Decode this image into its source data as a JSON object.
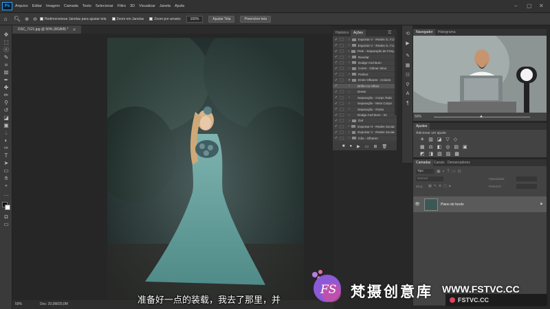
{
  "app": {
    "logo_text": "Ps"
  },
  "menu": [
    "Arquivo",
    "Editar",
    "Imagem",
    "Camada",
    "Texto",
    "Selecionar",
    "Filtro",
    "3D",
    "Visualizar",
    "Janela",
    "Ajuda"
  ],
  "options": {
    "resize_windows": "Redimensionar Janelas para ajustar tela",
    "zoom_all": "Zoom em Janelas",
    "scrubby_zoom": "Zoom por arrasto",
    "zoom_value": "100%",
    "fit_screen": "Ajustar Tela",
    "fill_screen": "Preencher tela"
  },
  "document": {
    "tab_title": "DSC_7121.jpg @ 50% (RGB/8) *",
    "zoom": "50%",
    "doc_size": "Doc: 20,0M/20,0M"
  },
  "actions_panel": {
    "tabs": [
      "Histórico",
      "Ações"
    ],
    "active_tab": "Ações",
    "rows": [
      {
        "label": "Exportar V - Redes S...",
        "key": "F12",
        "checked": true
      },
      {
        "label": "Exportar V - Redes S...",
        "key": "F11",
        "checked": true
      },
      {
        "label": "Pele - Separação de Freq...",
        "key": "",
        "checked": true
      },
      {
        "label": "Revelar",
        "key": "",
        "checked": true
      },
      {
        "label": "Dodge And Burn",
        "key": "",
        "checked": true
      },
      {
        "label": "Cores - Gilmar Silva",
        "key": "",
        "checked": true
      },
      {
        "label": "Perfect",
        "key": "",
        "checked": true
      },
      {
        "label": "Entre Olhares - Actions",
        "key": "",
        "checked": true
      },
      {
        "label": "Brilho no Olhos",
        "key": "",
        "checked": true
      },
      {
        "label": "Dente",
        "key": "",
        "checked": true
      },
      {
        "label": "Separação - Corpo Todo",
        "key": "",
        "checked": true
      },
      {
        "label": "Separação - Meio Corpo",
        "key": "",
        "checked": true
      },
      {
        "label": "Separação - Rosto",
        "key": "",
        "checked": true
      },
      {
        "label": "Dodge And Burn - 01",
        "key": "",
        "checked": true
      },
      {
        "label": "Dal",
        "key": "",
        "checked": true
      },
      {
        "label": "Exportar H - Redes Sociais",
        "key": "",
        "checked": true
      },
      {
        "label": "Exportar V - Redes Sociais",
        "key": "",
        "checked": true
      },
      {
        "label": "Cão - Olhares",
        "key": "",
        "checked": true
      }
    ]
  },
  "navigator_panel": {
    "tabs": [
      "Navegador",
      "Histograma"
    ],
    "active_tab": "Navegador",
    "zoom": "50%"
  },
  "adjustments_panel": {
    "title": "Ajustes",
    "subtitle": "Adicionar um ajuste"
  },
  "layers_panel": {
    "tabs": [
      "Camadas",
      "Canais",
      "Demarcadores"
    ],
    "active_tab": "Camadas",
    "filter": "Tipo",
    "blend_mode": "Normal",
    "opacity_label": "Opacidade:",
    "lock_label": "Bloq.:",
    "fill_label": "Preench.:",
    "layer_name": "Plano de fundo"
  },
  "subtitle_text": "准备好一点的装载，我去了那里，并",
  "watermark": {
    "logo_letters": "FS",
    "brand": "梵摄创意库",
    "url": "WWW.FSTVC.CC",
    "corner_text": "FSTVC.CC"
  }
}
